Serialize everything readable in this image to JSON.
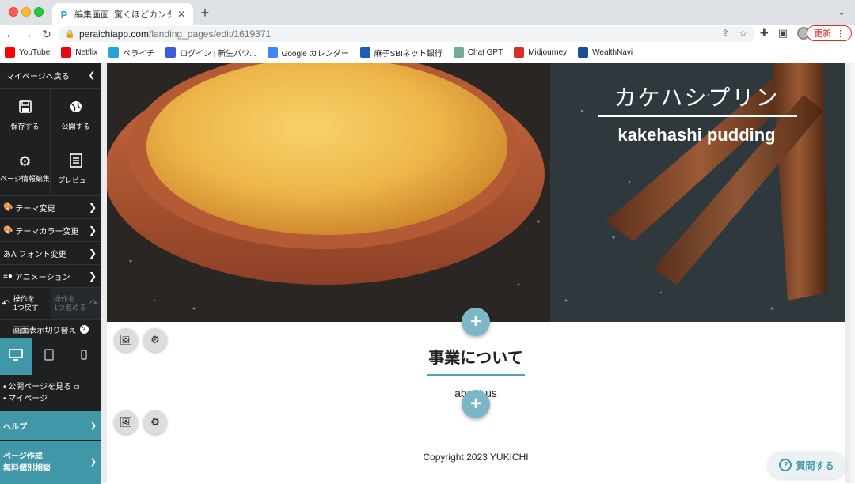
{
  "browser": {
    "tab_title": "編集画面: 驚くほどカンタン！無料",
    "url_host": "peraichiapp.com",
    "url_path": "/landing_pages/edit/1619371",
    "update_label": "更新",
    "bookmarks": [
      {
        "label": "YouTube",
        "icon": "youtube-icon",
        "color": "#ff0000"
      },
      {
        "label": "Netflix",
        "icon": "netflix-icon",
        "color": "#e50914"
      },
      {
        "label": "ペライチ",
        "icon": "peraichi-icon",
        "color": "#2aa0d8"
      },
      {
        "label": "ログイン | 新生パワ...",
        "icon": "login-site-icon",
        "color": "#3b5bdb"
      },
      {
        "label": "Google カレンダー",
        "icon": "google-calendar-icon",
        "color": "#4285f4"
      },
      {
        "label": "麻子SBIネット銀行",
        "icon": "bank-icon",
        "color": "#1a5fb4"
      },
      {
        "label": "Chat GPT",
        "icon": "chatgpt-icon",
        "color": "#74aa9c"
      },
      {
        "label": "Midjourney",
        "icon": "midjourney-icon",
        "color": "#d93025"
      },
      {
        "label": "WealthNavi",
        "icon": "wealthnavi-icon",
        "color": "#1f4e99"
      }
    ]
  },
  "sidebar": {
    "back_label": "マイページへ戻る",
    "save_label": "保存する",
    "publish_label": "公開する",
    "page_info_label": "ページ情報編集",
    "preview_label": "プレビュー",
    "menu": [
      {
        "label": "テーマ変更",
        "icon": "theme-icon"
      },
      {
        "label": "テーマカラー変更",
        "icon": "palette-icon"
      },
      {
        "label": "フォント変更",
        "icon": "font-icon"
      },
      {
        "label": "アニメーション",
        "icon": "animation-icon"
      }
    ],
    "undo_label_1": "操作を",
    "undo_label_2": "1つ戻す",
    "redo_label_1": "操作を",
    "redo_label_2": "1つ進める",
    "switch_label": "画面表示切り替え",
    "link_public": "公開ページを見る",
    "link_mypage": "マイページ",
    "help_label": "ヘルプ",
    "consult_label_1": "ページ作成",
    "consult_label_2": "無料個別相談"
  },
  "hero": {
    "title": "カケハシプリン",
    "subtitle": "kakehashi pudding"
  },
  "about": {
    "title": "事業について",
    "subtitle": "about us"
  },
  "footer": {
    "copyright": "Copyright 2023 YUKICHI"
  },
  "support": {
    "question_label": "質問する"
  },
  "colors": {
    "accent": "#3f97a8",
    "plus_button": "#7db6c4",
    "sidebar_bg": "#1e2022"
  }
}
